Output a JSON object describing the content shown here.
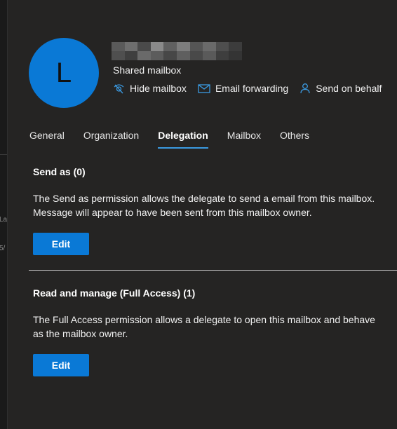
{
  "backdrop": {
    "fragments": [
      "La",
      "5/"
    ]
  },
  "header": {
    "avatar_initial": "L",
    "subtitle": "Shared mailbox",
    "actions": [
      {
        "label": "Hide mailbox",
        "icon": "hide-eye-icon"
      },
      {
        "label": "Email forwarding",
        "icon": "mail-forward-icon"
      },
      {
        "label": "Send on behalf",
        "icon": "person-icon"
      }
    ]
  },
  "tabs": [
    {
      "label": "General",
      "active": false
    },
    {
      "label": "Organization",
      "active": false
    },
    {
      "label": "Delegation",
      "active": true
    },
    {
      "label": "Mailbox",
      "active": false
    },
    {
      "label": "Others",
      "active": false
    }
  ],
  "sections": {
    "send_as": {
      "title": "Send as (0)",
      "desc_line1": "The Send as permission allows the delegate to send a email from this mailbox.",
      "desc_line2": "Message will appear to have been sent from this mailbox owner.",
      "button": "Edit"
    },
    "full_access": {
      "title": "Read and manage (Full Access) (1)",
      "desc_line1": "The Full Access permission allows a delegate to open this mailbox and behave",
      "desc_line2": "as the mailbox owner.",
      "button": "Edit"
    }
  },
  "colors": {
    "accent": "#0a79d6",
    "panel_bg": "#252423",
    "tab_underline": "#3b9ae1"
  }
}
